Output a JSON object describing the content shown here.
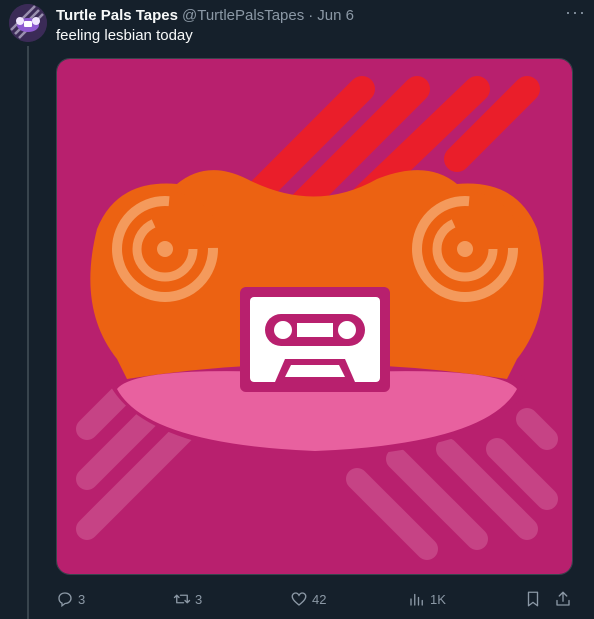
{
  "tweet": {
    "display_name": "Turtle Pals Tapes",
    "handle": "@TurtlePalsTapes",
    "separator": "·",
    "date": "Jun 6",
    "more_label": "···",
    "text": "feeling lesbian today",
    "media_description_icon": "turtle-cassette-logo",
    "colors": {
      "background": "#b8206e",
      "orange": "#ec6212",
      "light_orange": "#f49a5c",
      "pink": "#e8619f",
      "red": "#ea1e2a",
      "stripe": "#c94a8a"
    }
  },
  "actions": {
    "reply_count": "3",
    "retweet_count": "3",
    "like_count": "42",
    "views_count": "1K"
  }
}
